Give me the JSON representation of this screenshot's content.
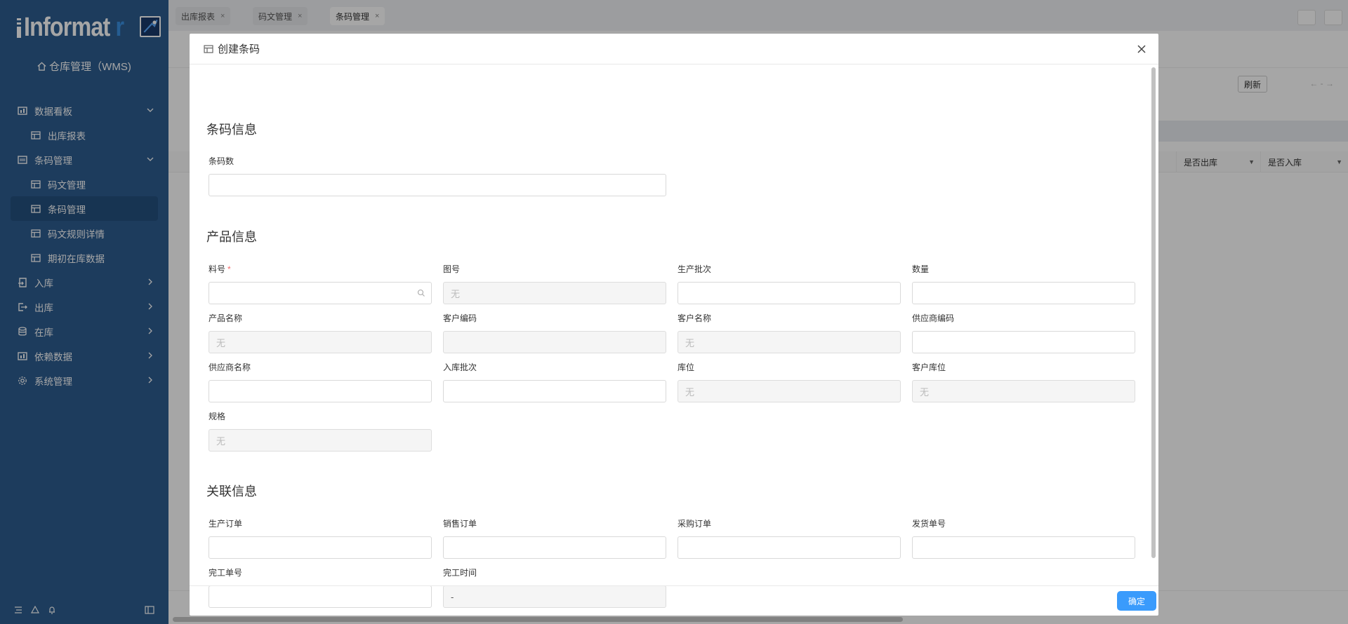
{
  "sidebar": {
    "logo_text": "Informat",
    "logo_suffix": "r",
    "app_title": "仓库管理（WMS)",
    "menu": [
      {
        "label": "数据看板",
        "icon": "dashboard-icon",
        "type": "group",
        "expanded": true
      },
      {
        "label": "出库报表",
        "icon": "table-icon",
        "type": "sub"
      },
      {
        "label": "条码管理",
        "icon": "barcode-icon",
        "type": "group",
        "expanded": true
      },
      {
        "label": "码文管理",
        "icon": "table-icon",
        "type": "sub"
      },
      {
        "label": "条码管理",
        "icon": "table-icon",
        "type": "sub",
        "active": true
      },
      {
        "label": "码文规则详情",
        "icon": "table-icon",
        "type": "sub"
      },
      {
        "label": "期初在库数据",
        "icon": "table-icon",
        "type": "sub"
      },
      {
        "label": "入库",
        "icon": "inbound-icon",
        "type": "group",
        "expanded": false
      },
      {
        "label": "出库",
        "icon": "outbound-icon",
        "type": "group",
        "expanded": false
      },
      {
        "label": "在库",
        "icon": "database-icon",
        "type": "group",
        "expanded": false
      },
      {
        "label": "依赖数据",
        "icon": "dependency-icon",
        "type": "group",
        "expanded": false
      },
      {
        "label": "系统管理",
        "icon": "gear-icon",
        "type": "group",
        "expanded": false
      }
    ]
  },
  "tabs": [
    {
      "label": "出库报表",
      "active": false
    },
    {
      "label": "码文管理",
      "active": false
    },
    {
      "label": "条码管理",
      "active": true
    }
  ],
  "background": {
    "refresh_label": "刷新",
    "page_indicator": "-",
    "columns": [
      "是否出库",
      "是否入库"
    ]
  },
  "modal": {
    "title": "创建条码",
    "confirm_label": "确定",
    "sections": {
      "barcode_info": "条码信息",
      "product_info": "产品信息",
      "related_info": "关联信息"
    },
    "fields": {
      "barcode_count": {
        "label": "条码数",
        "value": ""
      },
      "item_no": {
        "label": "料号",
        "value": "",
        "required": true
      },
      "drawing_no": {
        "label": "图号",
        "value": "无"
      },
      "production_batch": {
        "label": "生产批次",
        "value": ""
      },
      "quantity": {
        "label": "数量",
        "value": ""
      },
      "product_name": {
        "label": "产品名称",
        "value": "无"
      },
      "customer_code": {
        "label": "客户编码",
        "value": ""
      },
      "customer_name": {
        "label": "客户名称",
        "value": "无"
      },
      "supplier_code": {
        "label": "供应商编码",
        "value": ""
      },
      "supplier_name": {
        "label": "供应商名称",
        "value": ""
      },
      "inbound_batch": {
        "label": "入库批次",
        "value": ""
      },
      "location": {
        "label": "库位",
        "value": "无"
      },
      "customer_location": {
        "label": "客户库位",
        "value": "无"
      },
      "spec": {
        "label": "规格",
        "value": "无"
      },
      "production_order": {
        "label": "生产订单",
        "value": ""
      },
      "sales_order": {
        "label": "销售订单",
        "value": ""
      },
      "purchase_order": {
        "label": "采购订单",
        "value": ""
      },
      "delivery_no": {
        "label": "发货单号",
        "value": ""
      },
      "completion_no": {
        "label": "完工单号",
        "value": ""
      },
      "completion_time": {
        "label": "完工时间",
        "value": "-"
      }
    }
  },
  "colors": {
    "sidebar_bg": "#2d5c8f",
    "sidebar_active": "#24507f",
    "primary_button": "#3a9bfc",
    "required_mark": "#f56c6c"
  }
}
